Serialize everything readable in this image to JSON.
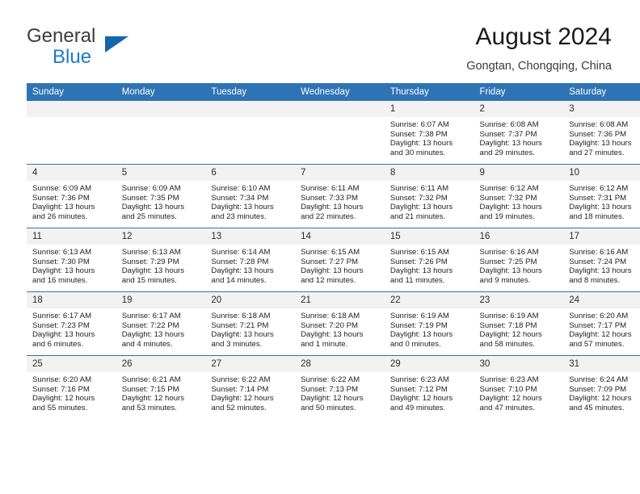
{
  "brand": {
    "line1": "General",
    "line2": "Blue",
    "triangle_icon": "brand-triangle-icon",
    "color_dark": "#3c3c3c",
    "color_blue": "#1f7ac4"
  },
  "header": {
    "title": "August 2024",
    "subtitle": "Gongtan, Chongqing, China"
  },
  "theme": {
    "header_row_bg": "#2e74b5",
    "day_number_bg": "#f2f2f2",
    "grid_line": "#2e74b5",
    "text": "#1f1f1f"
  },
  "weekdays": [
    "Sunday",
    "Monday",
    "Tuesday",
    "Wednesday",
    "Thursday",
    "Friday",
    "Saturday"
  ],
  "weeks": [
    [
      {
        "day": "",
        "blank": true,
        "lines": []
      },
      {
        "day": "",
        "blank": true,
        "lines": []
      },
      {
        "day": "",
        "blank": true,
        "lines": []
      },
      {
        "day": "",
        "blank": true,
        "lines": []
      },
      {
        "day": "1",
        "lines": [
          "Sunrise: 6:07 AM",
          "Sunset: 7:38 PM",
          "Daylight: 13 hours",
          "and 30 minutes."
        ]
      },
      {
        "day": "2",
        "lines": [
          "Sunrise: 6:08 AM",
          "Sunset: 7:37 PM",
          "Daylight: 13 hours",
          "and 29 minutes."
        ]
      },
      {
        "day": "3",
        "lines": [
          "Sunrise: 6:08 AM",
          "Sunset: 7:36 PM",
          "Daylight: 13 hours",
          "and 27 minutes."
        ]
      }
    ],
    [
      {
        "day": "4",
        "lines": [
          "Sunrise: 6:09 AM",
          "Sunset: 7:36 PM",
          "Daylight: 13 hours",
          "and 26 minutes."
        ]
      },
      {
        "day": "5",
        "lines": [
          "Sunrise: 6:09 AM",
          "Sunset: 7:35 PM",
          "Daylight: 13 hours",
          "and 25 minutes."
        ]
      },
      {
        "day": "6",
        "lines": [
          "Sunrise: 6:10 AM",
          "Sunset: 7:34 PM",
          "Daylight: 13 hours",
          "and 23 minutes."
        ]
      },
      {
        "day": "7",
        "lines": [
          "Sunrise: 6:11 AM",
          "Sunset: 7:33 PM",
          "Daylight: 13 hours",
          "and 22 minutes."
        ]
      },
      {
        "day": "8",
        "lines": [
          "Sunrise: 6:11 AM",
          "Sunset: 7:32 PM",
          "Daylight: 13 hours",
          "and 21 minutes."
        ]
      },
      {
        "day": "9",
        "lines": [
          "Sunrise: 6:12 AM",
          "Sunset: 7:32 PM",
          "Daylight: 13 hours",
          "and 19 minutes."
        ]
      },
      {
        "day": "10",
        "lines": [
          "Sunrise: 6:12 AM",
          "Sunset: 7:31 PM",
          "Daylight: 13 hours",
          "and 18 minutes."
        ]
      }
    ],
    [
      {
        "day": "11",
        "lines": [
          "Sunrise: 6:13 AM",
          "Sunset: 7:30 PM",
          "Daylight: 13 hours",
          "and 16 minutes."
        ]
      },
      {
        "day": "12",
        "lines": [
          "Sunrise: 6:13 AM",
          "Sunset: 7:29 PM",
          "Daylight: 13 hours",
          "and 15 minutes."
        ]
      },
      {
        "day": "13",
        "lines": [
          "Sunrise: 6:14 AM",
          "Sunset: 7:28 PM",
          "Daylight: 13 hours",
          "and 14 minutes."
        ]
      },
      {
        "day": "14",
        "lines": [
          "Sunrise: 6:15 AM",
          "Sunset: 7:27 PM",
          "Daylight: 13 hours",
          "and 12 minutes."
        ]
      },
      {
        "day": "15",
        "lines": [
          "Sunrise: 6:15 AM",
          "Sunset: 7:26 PM",
          "Daylight: 13 hours",
          "and 11 minutes."
        ]
      },
      {
        "day": "16",
        "lines": [
          "Sunrise: 6:16 AM",
          "Sunset: 7:25 PM",
          "Daylight: 13 hours",
          "and 9 minutes."
        ]
      },
      {
        "day": "17",
        "lines": [
          "Sunrise: 6:16 AM",
          "Sunset: 7:24 PM",
          "Daylight: 13 hours",
          "and 8 minutes."
        ]
      }
    ],
    [
      {
        "day": "18",
        "lines": [
          "Sunrise: 6:17 AM",
          "Sunset: 7:23 PM",
          "Daylight: 13 hours",
          "and 6 minutes."
        ]
      },
      {
        "day": "19",
        "lines": [
          "Sunrise: 6:17 AM",
          "Sunset: 7:22 PM",
          "Daylight: 13 hours",
          "and 4 minutes."
        ]
      },
      {
        "day": "20",
        "lines": [
          "Sunrise: 6:18 AM",
          "Sunset: 7:21 PM",
          "Daylight: 13 hours",
          "and 3 minutes."
        ]
      },
      {
        "day": "21",
        "lines": [
          "Sunrise: 6:18 AM",
          "Sunset: 7:20 PM",
          "Daylight: 13 hours",
          "and 1 minute."
        ]
      },
      {
        "day": "22",
        "lines": [
          "Sunrise: 6:19 AM",
          "Sunset: 7:19 PM",
          "Daylight: 13 hours",
          "and 0 minutes."
        ]
      },
      {
        "day": "23",
        "lines": [
          "Sunrise: 6:19 AM",
          "Sunset: 7:18 PM",
          "Daylight: 12 hours",
          "and 58 minutes."
        ]
      },
      {
        "day": "24",
        "lines": [
          "Sunrise: 6:20 AM",
          "Sunset: 7:17 PM",
          "Daylight: 12 hours",
          "and 57 minutes."
        ]
      }
    ],
    [
      {
        "day": "25",
        "lines": [
          "Sunrise: 6:20 AM",
          "Sunset: 7:16 PM",
          "Daylight: 12 hours",
          "and 55 minutes."
        ]
      },
      {
        "day": "26",
        "lines": [
          "Sunrise: 6:21 AM",
          "Sunset: 7:15 PM",
          "Daylight: 12 hours",
          "and 53 minutes."
        ]
      },
      {
        "day": "27",
        "lines": [
          "Sunrise: 6:22 AM",
          "Sunset: 7:14 PM",
          "Daylight: 12 hours",
          "and 52 minutes."
        ]
      },
      {
        "day": "28",
        "lines": [
          "Sunrise: 6:22 AM",
          "Sunset: 7:13 PM",
          "Daylight: 12 hours",
          "and 50 minutes."
        ]
      },
      {
        "day": "29",
        "lines": [
          "Sunrise: 6:23 AM",
          "Sunset: 7:12 PM",
          "Daylight: 12 hours",
          "and 49 minutes."
        ]
      },
      {
        "day": "30",
        "lines": [
          "Sunrise: 6:23 AM",
          "Sunset: 7:10 PM",
          "Daylight: 12 hours",
          "and 47 minutes."
        ]
      },
      {
        "day": "31",
        "lines": [
          "Sunrise: 6:24 AM",
          "Sunset: 7:09 PM",
          "Daylight: 12 hours",
          "and 45 minutes."
        ]
      }
    ]
  ]
}
